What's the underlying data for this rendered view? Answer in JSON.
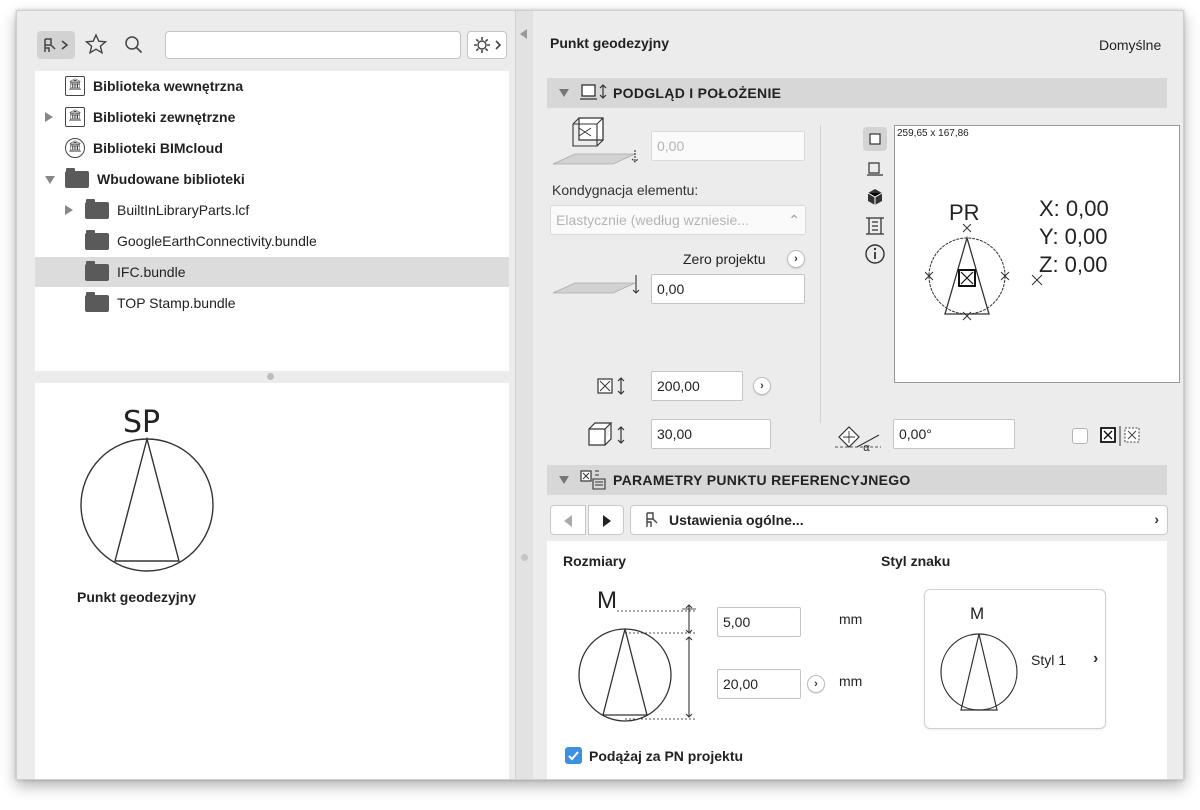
{
  "library": {
    "search_value": "",
    "tree": [
      {
        "label": "Biblioteka wewnętrzna",
        "type": "library-internal",
        "bold": true
      },
      {
        "label": "Biblioteki zewnętrzne",
        "type": "library-external",
        "bold": true
      },
      {
        "label": "Biblioteki BIMcloud",
        "type": "library-cloud",
        "bold": true
      },
      {
        "label": "Wbudowane biblioteki",
        "type": "folder",
        "bold": true
      },
      {
        "label": "BuiltInLibraryParts.lcf",
        "type": "folder",
        "bold": false
      },
      {
        "label": "GoogleEarthConnectivity.bundle",
        "type": "folder",
        "bold": false
      },
      {
        "label": "IFC.bundle",
        "type": "folder",
        "bold": false,
        "selected": true
      },
      {
        "label": "TOP Stamp.bundle",
        "type": "folder",
        "bold": false
      }
    ],
    "preview_marker": "SP",
    "preview_name": "Punkt geodezyjny"
  },
  "settings": {
    "object_name": "Punkt geodezyjny",
    "default_label": "Domyślne",
    "section_preview": {
      "title": "PODGLĄD I POŁOŻENIE",
      "elevation_value": "0,00",
      "story_label": "Kondygnacja elementu:",
      "story_select": "Elastycznie (według wzniesie...",
      "project_zero_label": "Zero projektu",
      "project_zero_value": "0,00",
      "width_value": "200,00",
      "height_value": "30,00",
      "angle_value": "0,00°",
      "preview_size": "259,65 x 167,86",
      "preview_marker": "PR",
      "coord_x": "X: 0,00",
      "coord_y": "Y: 0,00",
      "coord_z": "Z: 0,00"
    },
    "section_params": {
      "title": "PARAMETRY PUNKTU REFERENCYJNEGO",
      "nav_label": "Ustawienia ogólne...",
      "sizes_label": "Rozmiary",
      "style_label": "Styl znaku",
      "text_size_value": "5,00",
      "symbol_size_value": "20,00",
      "unit": "mm",
      "size_marker": "M",
      "style_marker": "M",
      "style_name": "Styl 1",
      "follow_label": "Podążaj za PN projektu",
      "follow_checked": true
    }
  },
  "colors": {
    "checkbox_accent": "#3d8fe0",
    "selected_row": "#dcdcdc"
  }
}
